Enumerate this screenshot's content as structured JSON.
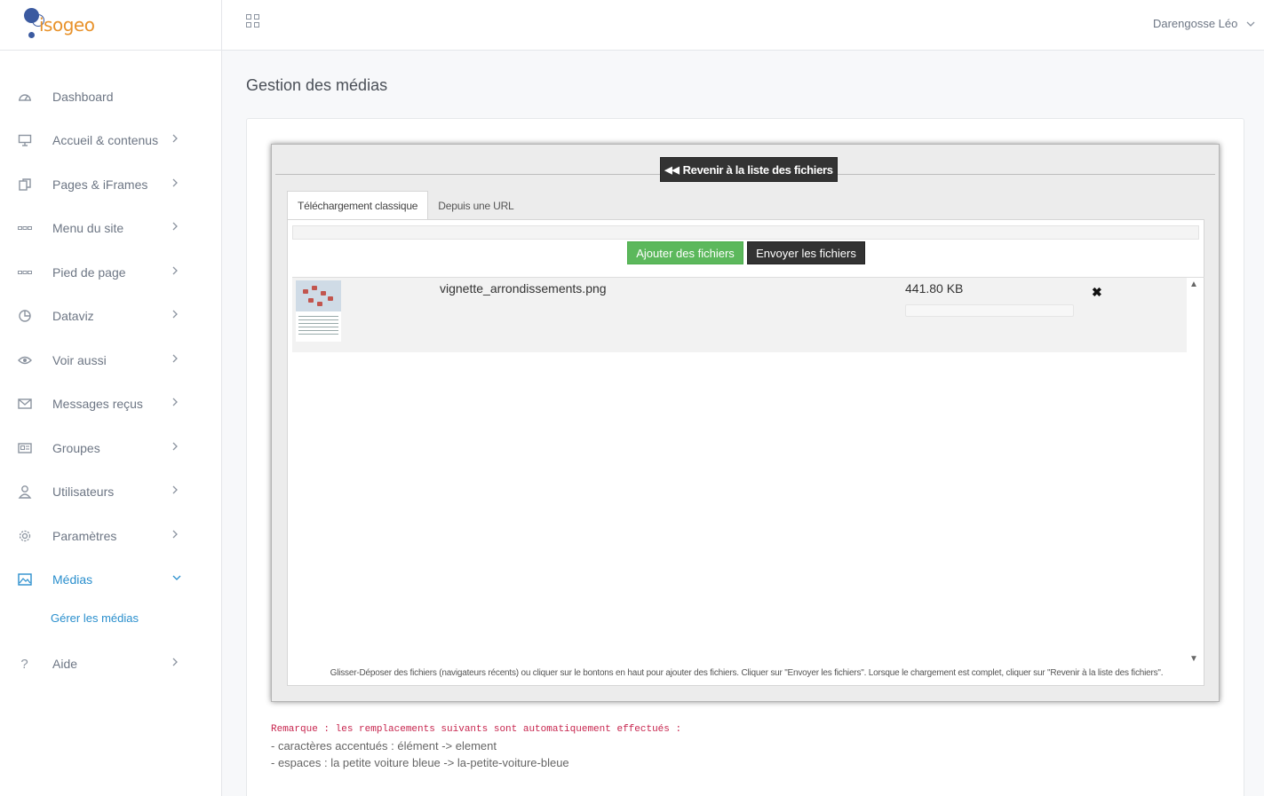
{
  "brand": {
    "logo_text": "isogeo"
  },
  "topbar": {
    "user_name": "Darengosse Léo"
  },
  "sidebar": {
    "items": [
      {
        "label": "Dashboard",
        "icon": "dashboard-icon"
      },
      {
        "label": "Accueil & contenus",
        "icon": "monitor-icon"
      },
      {
        "label": "Pages & iFrames",
        "icon": "pages-icon"
      },
      {
        "label": "Menu du site",
        "icon": "menu-dots-icon"
      },
      {
        "label": "Pied de page",
        "icon": "footer-dots-icon"
      },
      {
        "label": "Dataviz",
        "icon": "pie-chart-icon"
      },
      {
        "label": "Voir aussi",
        "icon": "eye-icon"
      },
      {
        "label": "Messages reçus",
        "icon": "envelope-icon"
      },
      {
        "label": "Groupes",
        "icon": "id-card-icon"
      },
      {
        "label": "Utilisateurs",
        "icon": "user-icon"
      },
      {
        "label": "Paramètres",
        "icon": "gear-icon"
      },
      {
        "label": "Médias",
        "icon": "image-icon"
      },
      {
        "label": "Aide",
        "icon": "question-icon"
      }
    ],
    "sub_item": "Gérer les médias"
  },
  "page": {
    "title": "Gestion des médias"
  },
  "uploader": {
    "back_button": "Revenir à la liste des fichiers",
    "tabs": [
      "Téléchargement classique",
      "Depuis une URL"
    ],
    "add_button": "Ajouter des fichiers",
    "send_button": "Envoyer les fichiers",
    "file": {
      "name": "vignette_arrondissements.png",
      "size": "441.80 KB",
      "remove_icon": "✖"
    },
    "hint": "Glisser-Déposer des fichiers (navigateurs récents) ou cliquer sur le bontons en haut pour ajouter des fichiers. Cliquer sur \"Envoyer les fichiers\". Lorsque le chargement est complet, cliquer sur \"Revenir à la liste des fichiers\"."
  },
  "notes": {
    "remark": "Remarque : les remplacements suivants sont automatiquement effectués :",
    "line1": "- caractères accentués : élément -> element",
    "line2": "- espaces : la petite voiture bleue -> la-petite-voiture-bleue"
  },
  "colors": {
    "accent": "#2a8fcd",
    "success": "#5cb85c",
    "dark": "#333333",
    "logo_orange": "#e8922b",
    "logo_blue": "#3b5aa0"
  }
}
